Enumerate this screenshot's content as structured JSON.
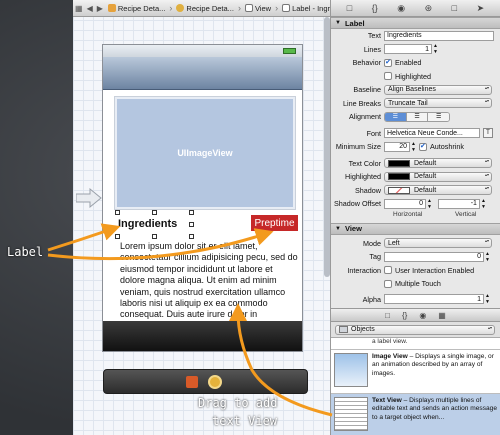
{
  "jumpbar": {
    "crumbs": [
      "Recipe Deta...",
      "Recipe Deta...",
      "View",
      "Label - Ingredients"
    ]
  },
  "canvas": {
    "image_view_label": "UIImageView",
    "ingredients_label": "Ingredients",
    "preptime_label": "Preptime",
    "body_text": "Lorem ipsum dolor sit er elit lamet, consectetaur cillium adipisicing pecu, sed do eiusmod tempor incididunt ut labore et dolore magna aliqua. Ut enim ad minim veniam, quis nostrud exercitation ullamco laboris nisi ut aliquip ex ea commodo consequat. Duis aute irure dolor in"
  },
  "annotations": {
    "label_note": "Label",
    "drag_note_line1": "Drag to add",
    "drag_note_line2": "text View",
    "arrow_color": "#f39a1e"
  },
  "inspector": {
    "label_section": {
      "title": "Label",
      "text_label": "Text",
      "text_value": "Ingredients",
      "lines_label": "Lines",
      "lines_value": "1",
      "behavior_label": "Behavior",
      "enabled_label": "Enabled",
      "highlighted_label": "Highlighted",
      "baseline_label": "Baseline",
      "baseline_value": "Align Baselines",
      "linebreaks_label": "Line Breaks",
      "linebreaks_value": "Truncate Tail",
      "alignment_label": "Alignment",
      "font_label": "Font",
      "font_value": "Helvetica Neue Conde...",
      "minsize_label": "Minimum Size",
      "minsize_value": "20",
      "autoshrink_label": "Autoshrink",
      "textcolor_label": "Text Color",
      "textcolor_value": "Default",
      "highlighted_color_label": "Highlighted",
      "highlighted_color_value": "Default",
      "shadow_label": "Shadow",
      "shadow_value": "Default",
      "shadow_offset_label": "Shadow Offset",
      "shadow_offset_h": "0",
      "shadow_offset_v": "-1",
      "horizontal_label": "Horizontal",
      "vertical_label": "Vertical"
    },
    "view_section": {
      "title": "View",
      "mode_label": "Mode",
      "mode_value": "Left",
      "tag_label": "Tag",
      "tag_value": "0",
      "interaction_label": "Interaction",
      "user_interaction_label": "User Interaction Enabled",
      "multiple_touch_label": "Multiple Touch",
      "alpha_label": "Alpha",
      "alpha_value": "1"
    },
    "library": {
      "filter_value": "Objects",
      "partial_item": "a label view.",
      "items": [
        {
          "title": "Image View",
          "desc": " – Displays a single image, or an animation described by an array of images."
        },
        {
          "title": "Text View",
          "desc": " – Displays multiple lines of editable text and sends an action message to a target object when..."
        }
      ]
    }
  }
}
